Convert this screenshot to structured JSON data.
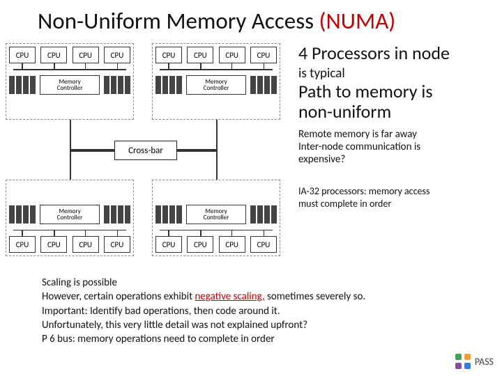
{
  "title": {
    "main": "Non-Uniform Memory Access ",
    "suffix": "(NUMA)"
  },
  "labels": {
    "cpu": "CPU",
    "mc_line1": "Memory",
    "mc_line2": "Controller",
    "crossbar": "Cross-bar"
  },
  "side": {
    "line1": "4 Processors in node",
    "line2": "is typical",
    "line3a": "Path to memory is",
    "line3b": "non-uniform",
    "line4a": "Remote memory is far away",
    "line4b": "Inter-node communication is",
    "line4c": "expensive?",
    "line5a": "IA-32 processors: memory access",
    "line5b": "must complete in order"
  },
  "bottom": {
    "b1": "Scaling is possible",
    "b2a": "However, certain operations exhibit ",
    "b2neg": "negative scaling,",
    "b2b": " sometimes severely so.",
    "b3": "Important: Identify bad operations, then code around it.",
    "b4": "Unfortunately, this very little detail was not explained upfront?",
    "b5": "P 6 bus: memory operations need to complete in order"
  },
  "logo": {
    "text": "PASS"
  },
  "chart_data": {
    "type": "diagram",
    "topic": "NUMA architecture",
    "nodes": 4,
    "cpus_per_node": 4,
    "memory_controllers_per_node": 1,
    "dimm_groups_per_node": 2,
    "interconnect": "Cross-bar",
    "node_layout": "2x2 grid, nodes at corners, cross-bar at center",
    "edges": [
      {
        "from": "node0.memory_controller",
        "to": "crossbar"
      },
      {
        "from": "node1.memory_controller",
        "to": "crossbar"
      },
      {
        "from": "node2.memory_controller",
        "to": "crossbar"
      },
      {
        "from": "node3.memory_controller",
        "to": "crossbar"
      }
    ],
    "node_internal": "4 CPUs on shared bus connected to 1 Memory Controller flanked by 2 DIMM groups"
  }
}
